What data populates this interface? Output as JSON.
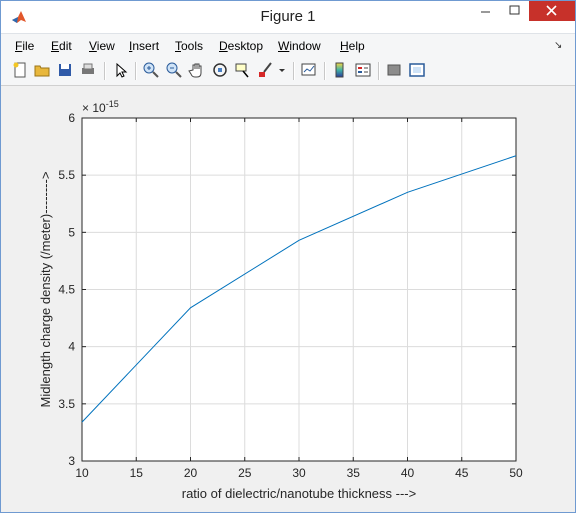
{
  "window": {
    "title": "Figure 1",
    "colors": {
      "titlebar": "#ffffff",
      "close_button": "#c7312a",
      "plot_line": "#0072bd",
      "grid": "#dcdcdc",
      "figure_bg": "#f0f0f0"
    }
  },
  "menu": {
    "items": [
      {
        "label": "File",
        "key": "F",
        "rest": "ile"
      },
      {
        "label": "Edit",
        "key": "E",
        "rest": "dit"
      },
      {
        "label": "View",
        "key": "V",
        "rest": "iew"
      },
      {
        "label": "Insert",
        "key": "I",
        "rest": "nsert"
      },
      {
        "label": "Tools",
        "key": "T",
        "rest": "ools"
      },
      {
        "label": "Desktop",
        "key": "D",
        "rest": "esktop"
      },
      {
        "label": "Window",
        "key": "W",
        "rest": "indow"
      },
      {
        "label": "Help",
        "key": "H",
        "rest": "elp"
      }
    ]
  },
  "toolbar": {
    "icons": [
      "new-figure-icon",
      "open-file-icon",
      "save-icon",
      "print-icon",
      "edit-plot-arrow-icon",
      "zoom-in-icon",
      "zoom-out-icon",
      "pan-hand-icon",
      "rotate-3d-icon",
      "data-cursor-icon",
      "brush-icon",
      "brush-dropdown-icon",
      "link-plot-icon",
      "colorbar-icon",
      "legend-icon",
      "hide-plot-tools-icon",
      "show-plot-tools-icon"
    ]
  },
  "chart_data": {
    "type": "line",
    "title": "",
    "xlabel": "ratio of dielectric/nanotube thickness --->",
    "ylabel": "Midlength charge density (/meter)-------->",
    "exponent_label": "× 10",
    "exponent_power": "-15",
    "xlim": [
      10,
      50
    ],
    "ylim": [
      3,
      6
    ],
    "x_ticks": [
      "10",
      "15",
      "20",
      "25",
      "30",
      "35",
      "40",
      "45",
      "50"
    ],
    "y_ticks": [
      "3",
      "3.5",
      "4",
      "4.5",
      "5",
      "5.5",
      "6"
    ],
    "grid": true,
    "series": [
      {
        "x": [
          10,
          20,
          30,
          40,
          50
        ],
        "y": [
          3.34,
          4.34,
          4.93,
          5.35,
          5.67
        ]
      }
    ]
  }
}
